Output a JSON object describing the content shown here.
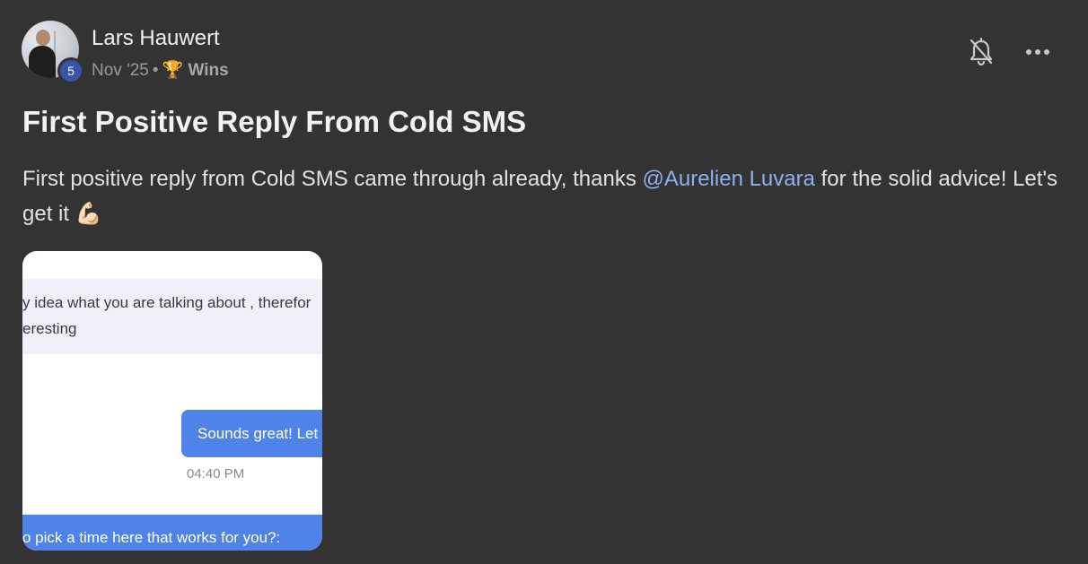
{
  "post": {
    "author_name": "Lars Hauwert",
    "level": "5",
    "date": "Nov '25",
    "separator": "•",
    "category_emoji": "🏆",
    "category": "Wins",
    "title": "First Positive Reply From Cold SMS",
    "body_before_mention": "First positive reply from Cold SMS came through already, thanks ",
    "mention": "@Aurelien Luvara",
    "body_after_mention": " for the solid advice! Let's get it 💪🏻"
  },
  "header_actions": {
    "bell_icon": "bell-off-icon",
    "more_icon": "more-horizontal-icon"
  },
  "attachment": {
    "incoming_line_1": "y idea what you are talking about , therefor",
    "incoming_line_2": "eresting",
    "outgoing_message": "Sounds great! Let",
    "timestamp": "04:40 PM",
    "bottom_message": "o pick a time here that works for you?:"
  },
  "colors": {
    "background": "#333333",
    "mention": "#8fb0ee",
    "level_badge": "#3a52a8",
    "sms_blue": "#4f83e9"
  }
}
